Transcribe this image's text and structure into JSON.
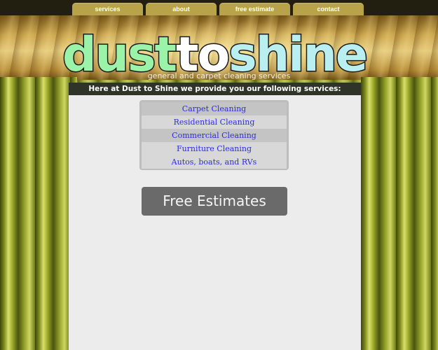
{
  "nav": {
    "tabs": [
      {
        "label": "services"
      },
      {
        "label": "about"
      },
      {
        "label": "free estimate"
      },
      {
        "label": "contact"
      }
    ]
  },
  "logo": {
    "part1": "dust",
    "part2": "to",
    "part3": "shine"
  },
  "tagline": "general and carpet cleaning services",
  "main": {
    "intro": "Here at Dust to Shine we provide you our following services:",
    "services": [
      {
        "label": "Carpet Cleaning"
      },
      {
        "label": "Residential Cleaning"
      },
      {
        "label": "Commercial Cleaning"
      },
      {
        "label": "Furniture Cleaning"
      },
      {
        "label": "Autos, boats, and RVs"
      }
    ],
    "cta_label": "Free Estimates"
  },
  "colors": {
    "nav_tab": "#b8a24a",
    "intro_bar": "#2f3428",
    "service_link": "#2b2be0",
    "cta_button": "#6a6a6a",
    "content_bg": "#ececec"
  }
}
